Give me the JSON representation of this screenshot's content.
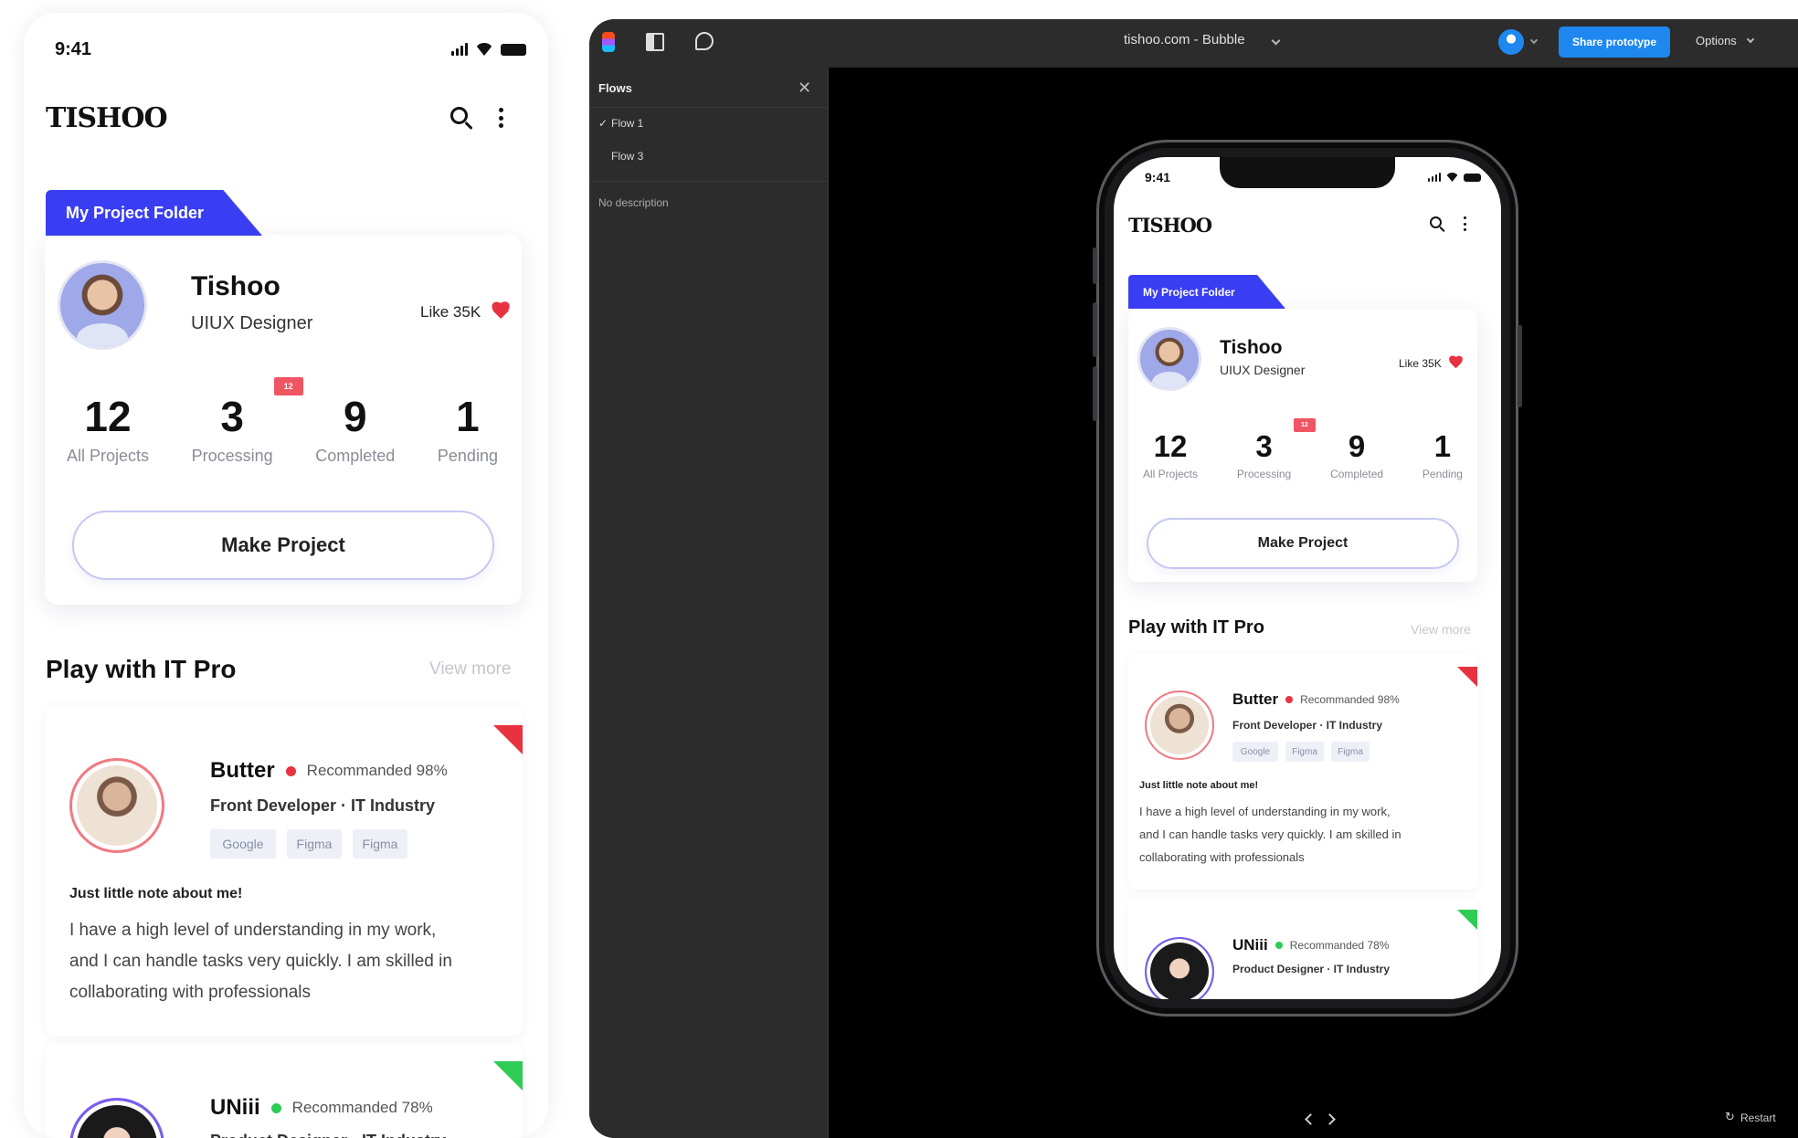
{
  "app": {
    "time": "9:41",
    "logo": "TISHOO",
    "folder_tab": "My Project Folder",
    "profile": {
      "name": "Tishoo",
      "role": "UIUX Designer",
      "like": "Like 35K"
    },
    "stats": [
      {
        "value": "12",
        "label": "All Projects"
      },
      {
        "value": "3",
        "label": "Processing",
        "badge": "12"
      },
      {
        "value": "9",
        "label": "Completed"
      },
      {
        "value": "1",
        "label": "Pending"
      }
    ],
    "make_project": "Make Project",
    "section_title": "Play with IT Pro",
    "view_more": "View more",
    "pros": [
      {
        "name": "Butter",
        "status_color": "#e8323f",
        "recommend": "Recommanded 98%",
        "role": "Front Developer · IT Industry",
        "tags": [
          "Google",
          "Figma",
          "Figma"
        ],
        "note_title": "Just little note about me!",
        "note_lines": [
          "I have a high level of understanding in my work,",
          "and I can handle tasks very quickly. I am skilled in",
          "collaborating with professionals"
        ],
        "corner_color": "#e8323f",
        "ring_color": "#f07a82"
      },
      {
        "name": "UNiii",
        "status_color": "#2ecc55",
        "recommend": "Recommanded 78%",
        "role": "Product Designer · IT Industry",
        "corner_color": "#2ecc55",
        "ring_color": "#7b5cf0"
      }
    ]
  },
  "editor": {
    "title": "tishoo.com - Bubble",
    "share": "Share prototype",
    "options": "Options",
    "flows_title": "Flows",
    "flows": [
      "Flow 1",
      "Flow 3"
    ],
    "no_description": "No description",
    "restart": "Restart"
  }
}
